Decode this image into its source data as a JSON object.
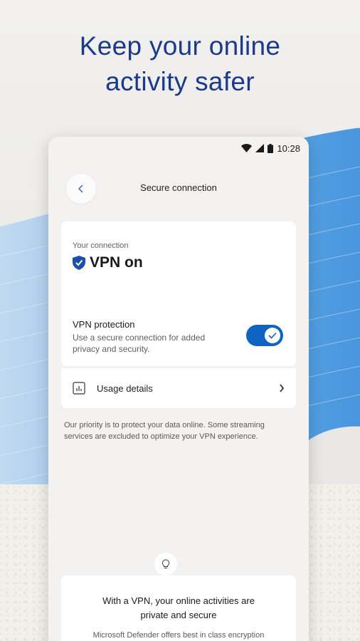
{
  "headline": {
    "line1": "Keep your online",
    "line2": "activity safer"
  },
  "status_bar": {
    "time": "10:28"
  },
  "app_bar": {
    "title": "Secure connection"
  },
  "connection": {
    "caption": "Your connection",
    "status": "VPN on"
  },
  "protection": {
    "title": "VPN protection",
    "description": "Use a secure connection for added privacy and security.",
    "enabled": true
  },
  "usage": {
    "label": "Usage details"
  },
  "note": "Our priority is to protect your data online. Some streaming services are excluded to optimize your VPN experience.",
  "promo": {
    "title": "With a VPN, your online activities are private and secure",
    "description": "Microsoft Defender offers best in class encryption"
  },
  "colors": {
    "headline": "#1b3a8a",
    "accent": "#0f63c2",
    "shield": "#1b4fa8"
  }
}
